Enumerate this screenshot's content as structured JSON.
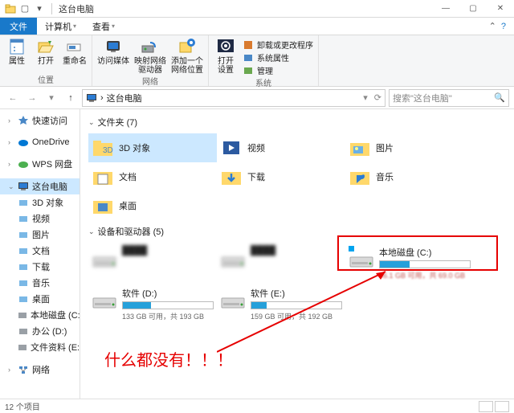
{
  "window": {
    "title": "这台电脑"
  },
  "tabs": {
    "file": "文件",
    "computer": "计算机",
    "view": "查看"
  },
  "ribbon": {
    "position": {
      "properties": "属性",
      "open": "打开",
      "rename": "重命名",
      "label": "位置"
    },
    "network": {
      "media": "访问媒体",
      "map_drive": "映射网络\n驱动器",
      "add_loc": "添加一个\n网络位置",
      "label": "网络"
    },
    "system": {
      "open_settings": "打开\n设置",
      "uninstall": "卸载或更改程序",
      "sysprops": "系统属性",
      "manage": "管理",
      "label": "系统"
    }
  },
  "nav": {
    "breadcrumb": "这台电脑",
    "search_placeholder": "搜索\"这台电脑\""
  },
  "sidebar": {
    "quick": "快速访问",
    "onedrive": "OneDrive",
    "wps": "WPS 网盘",
    "thispc": "这台电脑",
    "children": [
      {
        "label": "3D 对象"
      },
      {
        "label": "视频"
      },
      {
        "label": "图片"
      },
      {
        "label": "文档"
      },
      {
        "label": "下载"
      },
      {
        "label": "音乐"
      },
      {
        "label": "桌面"
      },
      {
        "label": "本地磁盘 (C:)"
      },
      {
        "label": "办公 (D:)"
      },
      {
        "label": "文件资料 (E:)"
      }
    ],
    "network": "网络"
  },
  "content": {
    "folders_hdr": "文件夹 (7)",
    "folders": [
      {
        "label": "3D 对象"
      },
      {
        "label": "视频"
      },
      {
        "label": "图片"
      },
      {
        "label": "文档"
      },
      {
        "label": "下载"
      },
      {
        "label": "音乐"
      },
      {
        "label": "桌面"
      }
    ],
    "drives_hdr": "设备和驱动器 (5)",
    "drives": [
      {
        "name": "",
        "meta": "",
        "blurred": true
      },
      {
        "name": "",
        "meta": "",
        "blurred": true
      },
      {
        "name": "本地磁盘 (C:)",
        "meta": "46.1 GB 可用，共 69.0 GB",
        "fill": 33
      },
      {
        "name": "软件 (D:)",
        "meta": "133 GB 可用，共 193 GB",
        "fill": 31
      },
      {
        "name": "软件 (E:)",
        "meta": "159 GB 可用，共 192 GB",
        "fill": 17
      }
    ]
  },
  "annotation": {
    "text": "什么都没有！！！"
  },
  "status": {
    "count": "12 个项目"
  }
}
